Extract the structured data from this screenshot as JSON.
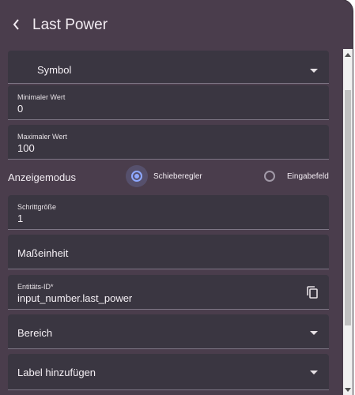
{
  "header": {
    "title": "Last Power"
  },
  "fields": {
    "symbol": {
      "label": "Symbol"
    },
    "min": {
      "label": "Minimaler Wert",
      "value": "0"
    },
    "max": {
      "label": "Maximaler Wert",
      "value": "100"
    },
    "mode": {
      "label": "Anzeigemodus",
      "options": [
        {
          "label": "Schieberegler",
          "selected": true
        },
        {
          "label": "Eingabefeld",
          "selected": false
        }
      ]
    },
    "step": {
      "label": "Schrittgröße",
      "value": "1"
    },
    "unit": {
      "label": "Maßeinheit"
    },
    "entity": {
      "label": "Entitäts-ID*",
      "value": "input_number.last_power"
    },
    "area": {
      "label": "Bereich"
    },
    "labels": {
      "label": "Label hinzufügen"
    }
  },
  "colors": {
    "dialog_bg": "#4a3d4c",
    "field_bg": "#3a3641",
    "accent": "#8ea8ff"
  }
}
